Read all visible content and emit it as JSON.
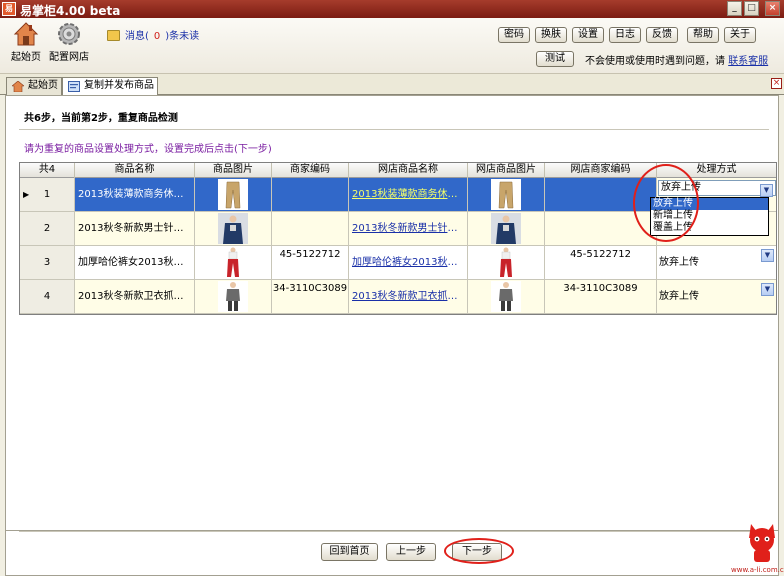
{
  "window": {
    "app_icon_text": "易",
    "title": "易掌柜4.00 beta",
    "minimize": "_",
    "maximize": "□",
    "close": "×"
  },
  "toolbar": {
    "home_label": "起始页",
    "config_label": "配置网店",
    "message_prefix": "消息(",
    "message_count": "0",
    "message_suffix": ")条未读",
    "buttons": [
      "密码",
      "换肤",
      "设置",
      "日志",
      "反馈",
      "帮助",
      "关于"
    ],
    "test_label": "测试",
    "hint_text": "不会使用或使用时遇到问题，请",
    "contact_link": "联系客服"
  },
  "tabs": [
    {
      "label": "起始页",
      "active": false
    },
    {
      "label": "复制并发布商品",
      "active": true
    }
  ],
  "tab_close": "×",
  "page": {
    "step_text": "共6步，当前第2步，重复商品检测",
    "instruction": "请为重复的商品设置处理方式，设置完成后点击(下一步)"
  },
  "grid": {
    "corner": "共4",
    "columns": [
      "商品名称",
      "商品图片",
      "商家编码",
      "网店商品名称",
      "网店商品图片",
      "网店商家编码",
      "处理方式"
    ],
    "rows": [
      {
        "index": "1",
        "name": "2013秋装薄款商务休闲裤...",
        "code": "",
        "shop_name": "2013秋装薄款商务休闲...",
        "shop_code": "",
        "action": "放弃上传",
        "selected": true
      },
      {
        "index": "2",
        "name": "2013秋冬新款男士针织衫...",
        "code": "",
        "shop_name": "2013秋冬新款男士针织...",
        "shop_code": "",
        "action": "",
        "selected": false
      },
      {
        "index": "3",
        "name": "加厚哈伦裤女2013秋冬新...",
        "code": "45-5122712",
        "shop_name": "加厚哈伦裤女2013秋冬...",
        "shop_code": "45-5122712",
        "action": "放弃上传",
        "selected": false
      },
      {
        "index": "4",
        "name": "2013秋冬新款卫衣抓绒加...",
        "code": "34-3110C3089",
        "shop_name": "2013秋冬新款卫衣抓绒...",
        "shop_code": "34-3110C3089",
        "action": "放弃上传",
        "selected": false
      }
    ],
    "dropdown_options": [
      "放弃上传",
      "新增上传",
      "覆盖上传"
    ],
    "dropdown_highlighted": "放弃上传"
  },
  "footer": {
    "home_button": "回到首页",
    "prev_button": "上一步",
    "next_button": "下一步",
    "watermark": "www.a-li.com.c"
  },
  "colors": {
    "selected_row": "#3168c9",
    "row_background": "#fffde7",
    "link": "#1a30a8",
    "highlight_ring": "#e0201a"
  }
}
